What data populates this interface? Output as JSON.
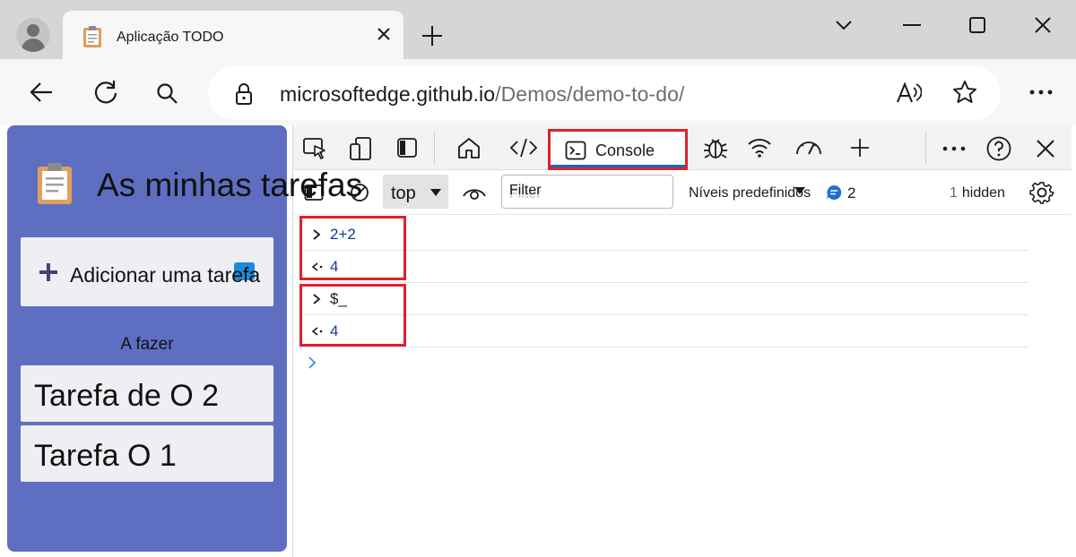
{
  "tab": {
    "title": "Aplicação TODO"
  },
  "address": {
    "domain": "microsoftedge.github.io",
    "path": "/Demos/demo-to-do/"
  },
  "icons": {
    "profile": "profile-avatar-icon",
    "favicon": "clipboard-icon",
    "tab_close": "close-icon",
    "new_tab": "plus-icon",
    "back": "arrow-left-icon",
    "refresh": "refresh-icon",
    "search": "search-icon",
    "lock": "lock-icon",
    "read_aloud": "read-aloud-icon",
    "favorite": "star-icon",
    "more": "more-dots-icon"
  },
  "app": {
    "heading": "As minhas tarefas",
    "add_task_label": "Adicionar uma tarefa",
    "section_title": "A fazer",
    "tasks": [
      "Tarefa de O 2",
      "Tarefa O 1"
    ]
  },
  "devtools": {
    "console_tab_label": "Console",
    "context": "top",
    "filter_placeholder": "Filter",
    "levels_label": "Níveis predefinidos",
    "message_count": "2",
    "hidden_count": "1",
    "hidden_label": "hidden",
    "entries": [
      {
        "kind": "input",
        "text": "2+2"
      },
      {
        "kind": "output",
        "text": "4"
      },
      {
        "kind": "input",
        "text": "$_"
      },
      {
        "kind": "output",
        "text": "4"
      }
    ]
  },
  "colors": {
    "app_bg": "#5e6fc1",
    "highlight": "#e0212c",
    "accent": "#0f6cbd"
  }
}
